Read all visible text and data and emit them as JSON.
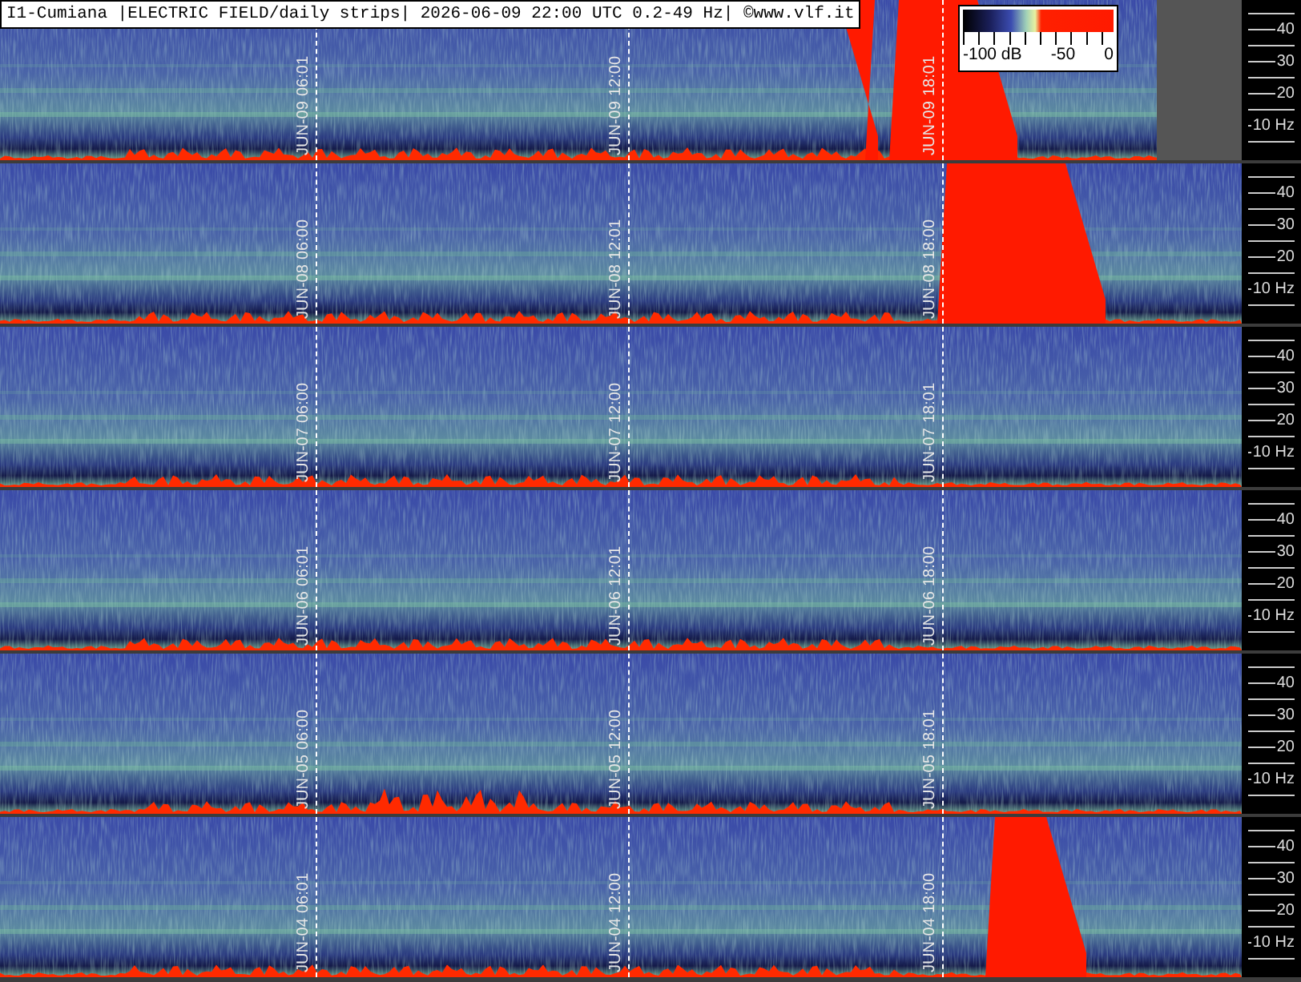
{
  "header": {
    "title": "I1-Cumiana |ELECTRIC FIELD/daily strips| 2026-06-09 22:00 UTC 0.2-49 Hz| ©www.vlf.it"
  },
  "legend": {
    "labels": [
      "-100 dB",
      "-50",
      "0"
    ]
  },
  "strips": [
    {
      "kind": "partial",
      "markers": [
        {
          "date": "JUN-09",
          "time": "06:01"
        },
        {
          "date": "JUN-09",
          "time": "12:00"
        },
        {
          "date": "JUN-09",
          "time": "18:01"
        }
      ],
      "axis": [
        "40",
        "30",
        "20",
        "10 Hz"
      ]
    },
    {
      "kind": "full",
      "markers": [
        {
          "date": "JUN-08",
          "time": "06:00"
        },
        {
          "date": "JUN-08",
          "time": "12:01"
        },
        {
          "date": "JUN-08",
          "time": "18:00"
        }
      ],
      "axis": [
        "40",
        "30",
        "20",
        "10 Hz"
      ]
    },
    {
      "kind": "full",
      "markers": [
        {
          "date": "JUN-07",
          "time": "06:00"
        },
        {
          "date": "JUN-07",
          "time": "12:00"
        },
        {
          "date": "JUN-07",
          "time": "18:01"
        }
      ],
      "axis": [
        "40",
        "30",
        "20",
        "10 Hz"
      ]
    },
    {
      "kind": "full",
      "markers": [
        {
          "date": "JUN-06",
          "time": "06:01"
        },
        {
          "date": "JUN-06",
          "time": "12:01"
        },
        {
          "date": "JUN-06",
          "time": "18:00"
        }
      ],
      "axis": [
        "40",
        "30",
        "20",
        "10 Hz"
      ]
    },
    {
      "kind": "full",
      "markers": [
        {
          "date": "JUN-05",
          "time": "06:00"
        },
        {
          "date": "JUN-05",
          "time": "12:00"
        },
        {
          "date": "JUN-05",
          "time": "18:01"
        }
      ],
      "axis": [
        "40",
        "30",
        "20",
        "10 Hz"
      ]
    },
    {
      "kind": "full",
      "markers": [
        {
          "date": "JUN-04",
          "time": "06:01"
        },
        {
          "date": "JUN-04",
          "time": "12:00"
        },
        {
          "date": "JUN-04",
          "time": "18:00"
        }
      ],
      "axis": [
        "40",
        "30",
        "20",
        "10 Hz"
      ]
    }
  ]
}
